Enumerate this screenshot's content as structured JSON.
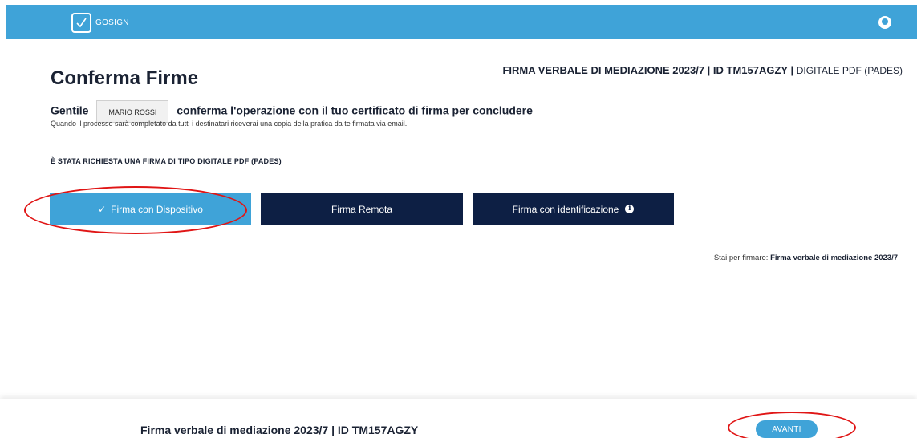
{
  "header": {
    "logo_text": "GOSIGN",
    "logo_icon": "check-square-icon",
    "user_icon": "user-avatar-icon"
  },
  "page": {
    "title": "Conferma Firme",
    "doc_bold": "FIRMA VERBALE DI MEDIAZIONE 2023/7 | ID TM157AGZY |",
    "doc_type": "DIGITALE PDF (PADES)",
    "greeting_prefix": "Gentile",
    "user_name": "MARIO ROSSI",
    "greeting_suffix": "conferma l'operazione con il tuo certificato di firma per concludere",
    "subtext": "Quando il processo sarà completato da tutti i destinatari riceverai una copia della pratica da te firmata via email.",
    "request_title": "È STATA RICHIESTA UNA FIRMA DI TIPO DIGITALE PDF (PADES)"
  },
  "sign_options": {
    "device": "Firma con Dispositivo",
    "remote": "Firma Remota",
    "identification": "Firma con identificazione"
  },
  "signing_note": {
    "prefix": "Stai per firmare:",
    "document": "Firma verbale di mediazione 2023/7"
  },
  "footer": {
    "title": "Firma verbale di mediazione 2023/7 | ID TM157AGZY",
    "next_label": "AVANTI"
  },
  "colors": {
    "accent": "#3fa3d8",
    "dark": "#0d1f44",
    "annotation": "#e01515"
  }
}
